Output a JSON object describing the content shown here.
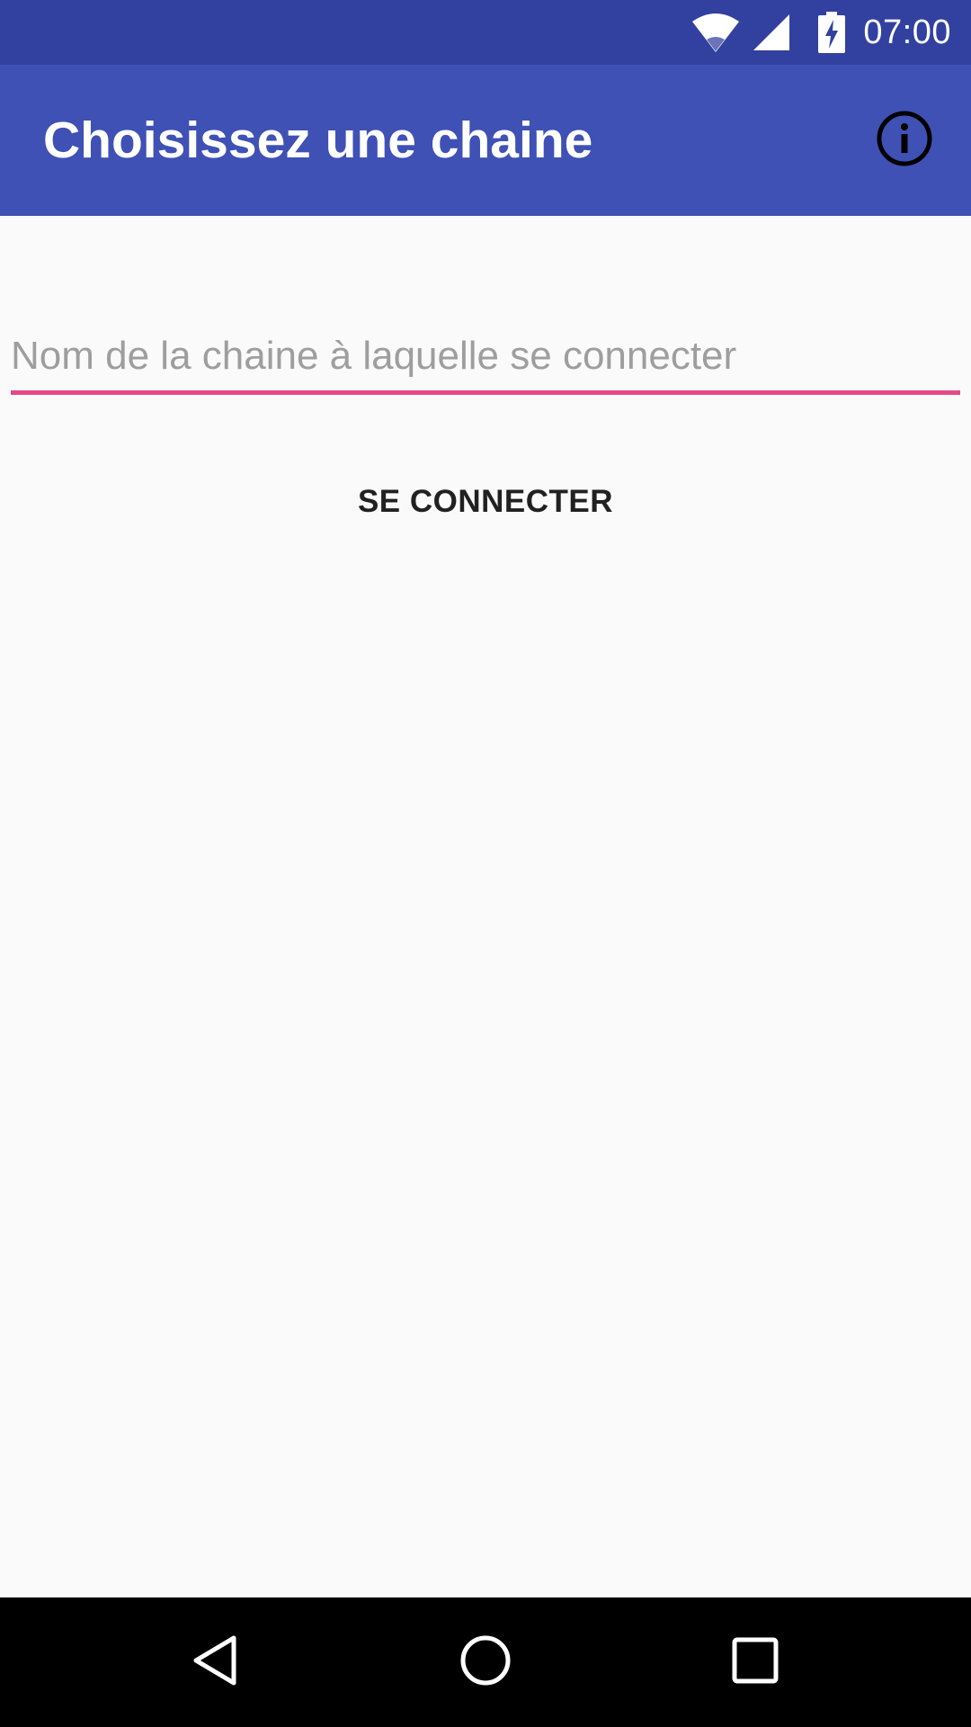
{
  "status_bar": {
    "time": "07:00",
    "icons": [
      "wifi-icon",
      "cell-signal-icon",
      "battery-charging-icon"
    ]
  },
  "app_bar": {
    "title": "Choisissez une chaine",
    "action_icon": "info-icon"
  },
  "form": {
    "channel_input": {
      "value": "",
      "placeholder": "Nom de la chaine à laquelle se connecter"
    },
    "connect_label": "SE CONNECTER"
  },
  "nav_bar": {
    "icons": [
      "back-icon",
      "home-icon",
      "recents-icon"
    ]
  },
  "colors": {
    "status_bar": "#3241a0",
    "app_bar": "#3f51b5",
    "accent": "#e64a86",
    "background": "#fafafa"
  }
}
